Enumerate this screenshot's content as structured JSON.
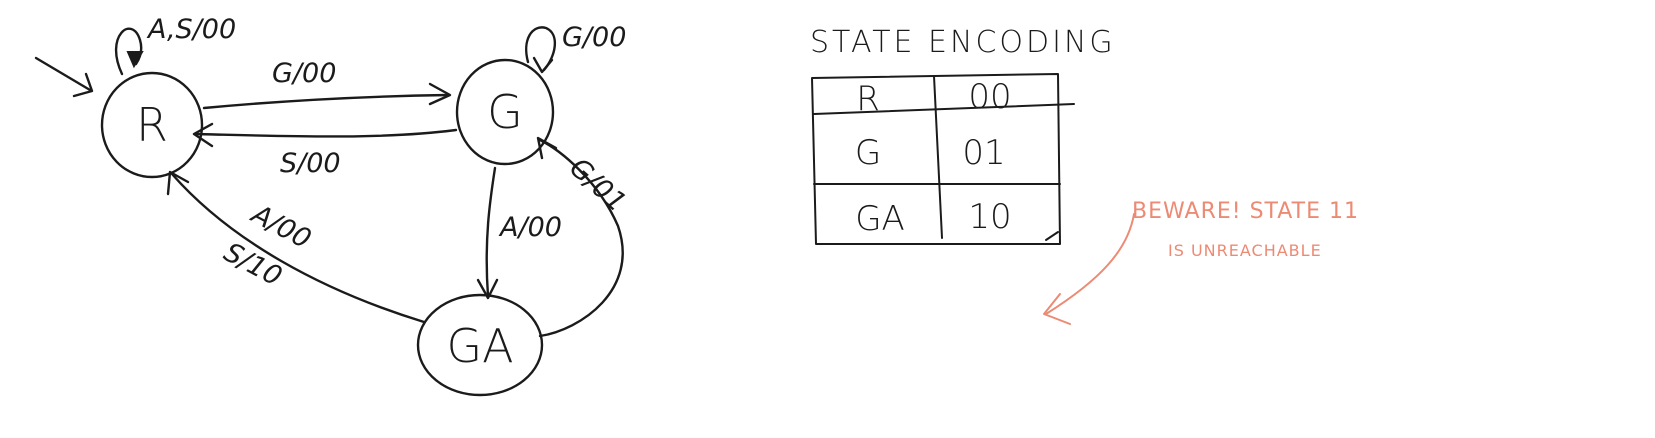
{
  "fsm": {
    "states": {
      "r": "R",
      "g": "G",
      "ga": "GA"
    },
    "transitions": {
      "r_self": "A,S/00",
      "r_to_g": "G/00",
      "g_to_r": "S/00",
      "g_self": "G/00",
      "g_to_ga": "A/00",
      "ga_to_g": "G/01",
      "ga_to_r_a": "A/00",
      "ga_to_r_s": "S/10"
    }
  },
  "encoding": {
    "title": "STATE ENCODING",
    "rows": [
      {
        "state": "R",
        "code": "00"
      },
      {
        "state": "G",
        "code": "01"
      },
      {
        "state": "GA",
        "code": "10"
      }
    ]
  },
  "note": {
    "line1": "BEWARE! STATE 11",
    "line2": "IS UNREACHABLE",
    "color": "#ec8a74"
  }
}
